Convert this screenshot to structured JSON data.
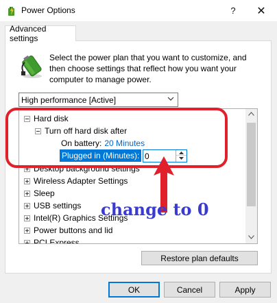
{
  "window": {
    "title": "Power Options",
    "help_glyph": "?",
    "close_glyph": "✕"
  },
  "tab": {
    "label": "Advanced settings"
  },
  "description": "Select the power plan that you want to customize, and then choose settings that reflect how you want your computer to manage power.",
  "plan": {
    "selected": "High performance [Active]"
  },
  "tree": {
    "hard_disk": "Hard disk",
    "turn_off": "Turn off hard disk after",
    "on_battery_label": "On battery:",
    "on_battery_value": "20 Minutes",
    "plugged_label": "Plugged in (Minutes):",
    "plugged_value": "0",
    "items": [
      "Desktop background settings",
      "Wireless Adapter Settings",
      "Sleep",
      "USB settings",
      "Intel(R) Graphics Settings",
      "Power buttons and lid",
      "PCI Express"
    ]
  },
  "buttons": {
    "restore": "Restore plan defaults",
    "ok": "OK",
    "cancel": "Cancel",
    "apply": "Apply"
  },
  "annotation": {
    "text": "change to 0",
    "color": "#e0202a",
    "text_color": "#3a3ad0"
  },
  "colors": {
    "accent": "#0078d7",
    "link": "#0066cc"
  }
}
